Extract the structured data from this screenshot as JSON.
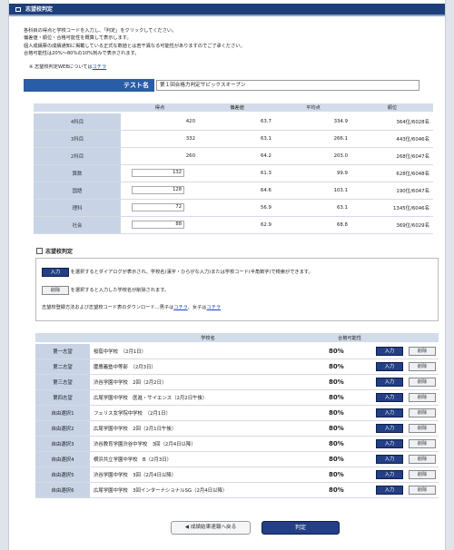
{
  "page_title": "志望校判定",
  "intro_lines": [
    "各科目の得点と学校コードを入力し、「判定」をクリックしてください。",
    "偏差値・順位・合格可能性を概算して表示します。",
    "個人成績票の成績通知に掲載している正式な数値とは若干異なる可能性がありますのでご了承ください。",
    "合格可能性は20%～80%の10%刻みで表示されます。"
  ],
  "note": {
    "prefix": "※ 志望校判定WEBについては",
    "link": "コチラ"
  },
  "test": {
    "label": "テスト名",
    "value": "第１回合格力判定サピックスオープン"
  },
  "score_table": {
    "headers": [
      "",
      "得点",
      "偏差値",
      "平均点",
      "順位"
    ],
    "rows": [
      {
        "label": "4科目",
        "score": "420",
        "dev": "63.7",
        "avg": "334.9",
        "rank": "364位/6028名",
        "editable": false
      },
      {
        "label": "3科目",
        "score": "332",
        "dev": "63.1",
        "avg": "266.1",
        "rank": "443位/6046名",
        "editable": false
      },
      {
        "label": "2科目",
        "score": "260",
        "dev": "64.2",
        "avg": "203.0",
        "rank": "268位/6047名",
        "editable": false
      },
      {
        "label": "算数",
        "score": "132",
        "dev": "61.3",
        "avg": "99.9",
        "rank": "628位/6048名",
        "editable": true
      },
      {
        "label": "国語",
        "score": "128",
        "dev": "64.6",
        "avg": "103.1",
        "rank": "190位/6047名",
        "editable": true
      },
      {
        "label": "理科",
        "score": "72",
        "dev": "56.9",
        "avg": "63.1",
        "rank": "1345位/6046名",
        "editable": true
      },
      {
        "label": "社会",
        "score": "88",
        "dev": "62.9",
        "avg": "68.8",
        "rank": "369位/6029名",
        "editable": true
      }
    ]
  },
  "section2": {
    "title": "志望校判定",
    "input_button": "入力",
    "input_desc": "を選択するとダイアログが表示され、学校名(漢字・ひらがな入力)または学校コード(半角数字)で検索ができます。",
    "delete_button": "削除",
    "delete_desc": "を選択すると入力した学校名が削除されます。",
    "download_prefix": "志望校登録方法および志望校コード表のダウンロード…男子は",
    "download_link_boys": "コチラ",
    "download_mid": "、女子は",
    "download_link_girls": "コチラ"
  },
  "school_table": {
    "headers": [
      "",
      "学校名",
      "合格可能性",
      "",
      ""
    ],
    "input_label": "入力",
    "delete_label": "削除",
    "rows": [
      {
        "label": "第一志望",
        "school": "桜蔭中学校　（2月1日）",
        "pct": "80%"
      },
      {
        "label": "第二志望",
        "school": "慶應義塾中等部　（2月3日）",
        "pct": "80%"
      },
      {
        "label": "第三志望",
        "school": "渋谷学園中学校　2回（2月2日）",
        "pct": "80%"
      },
      {
        "label": "第四志望",
        "school": "広尾学園中学校　医進・サイエンス（2月2日午後）",
        "pct": "80%"
      },
      {
        "label": "自由選択1",
        "school": "フェリス女学院中学校　（2月1日）",
        "pct": "80%"
      },
      {
        "label": "自由選択2",
        "school": "広尾学園中学校　2回（2月1日午後）",
        "pct": "80%"
      },
      {
        "label": "自由選択3",
        "school": "渋谷教育学園渋谷中学校　3回（2月4日以降）",
        "pct": "80%"
      },
      {
        "label": "自由選択4",
        "school": "横浜共立学園中学校　B（2月3日）",
        "pct": "80%"
      },
      {
        "label": "自由選択5",
        "school": "渋谷学園中学校　3回（2月4日以降）",
        "pct": "80%"
      },
      {
        "label": "自由選択6",
        "school": "広尾学園中学校　3回インターナショナルSG（2月4日以降）",
        "pct": "80%"
      }
    ]
  },
  "footer": {
    "back_label": "◀ 成績結果速報へ戻る",
    "judge_label": "判定"
  }
}
